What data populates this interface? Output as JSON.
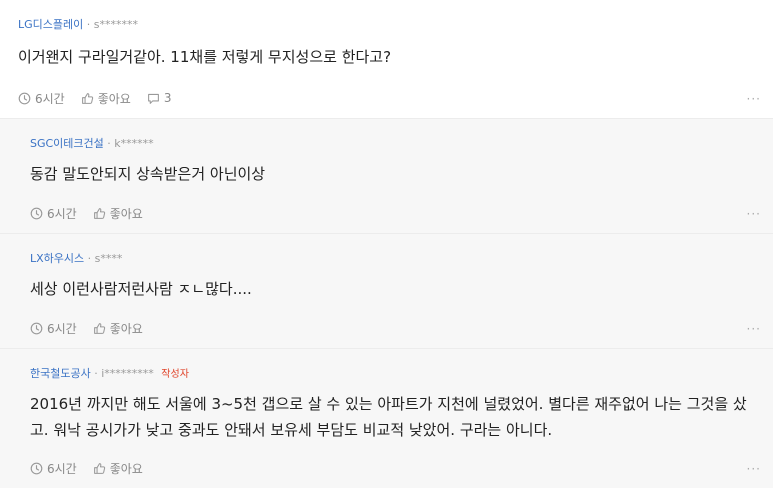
{
  "comments": [
    {
      "company": "LG디스플레이",
      "separator": "·",
      "user": "s*******",
      "body": "이거왠지 구라일거같아. 11채를 저렇게 무지성으로 한다고?",
      "time": "6시간",
      "like_label": "좋아요",
      "reply_count": "3",
      "more": "···"
    },
    {
      "company": "SGC이테크건설",
      "separator": "·",
      "user": "k******",
      "body": "동감 말도안되지 상속받은거 아닌이상",
      "time": "6시간",
      "like_label": "좋아요",
      "more": "···"
    },
    {
      "company": "LX하우시스",
      "separator": "·",
      "user": "s****",
      "body": "세상 이런사람저런사람 ㅈㄴ많다....",
      "time": "6시간",
      "like_label": "좋아요",
      "more": "···"
    },
    {
      "company": "한국철도공사",
      "separator": "·",
      "user": "i*********",
      "badge": "작성자",
      "body": "2016년 까지만 해도 서울에 3~5천 갭으로 살 수 있는 아파트가 지천에 널렸었어. 별다른 재주없어 나는 그것을 샀고. 워낙 공시가가 낮고 중과도 안돼서 보유세 부담도 비교적 낮았어. 구라는 아니다.",
      "time": "6시간",
      "like_label": "좋아요",
      "more": "···"
    }
  ]
}
